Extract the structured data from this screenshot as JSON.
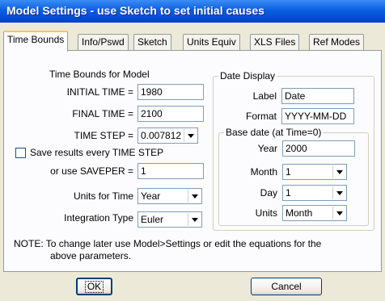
{
  "window": {
    "title": "Model Settings - use Sketch to set initial causes"
  },
  "tabs": [
    {
      "label": "Time Bounds",
      "active": true
    },
    {
      "label": "Info/Pswd",
      "active": false
    },
    {
      "label": "Sketch",
      "active": false
    },
    {
      "label": "Units Equiv",
      "active": false
    },
    {
      "label": "XLS Files",
      "active": false
    },
    {
      "label": "Ref Modes",
      "active": false
    }
  ],
  "time_bounds": {
    "heading": "Time Bounds for Model",
    "initial_time": {
      "label": "INITIAL TIME =",
      "value": "1980"
    },
    "final_time": {
      "label": "FINAL TIME =",
      "value": "2100"
    },
    "time_step": {
      "label": "TIME STEP =",
      "value": "0.007812"
    },
    "save_every": {
      "label": "Save results every TIME STEP",
      "checked": false
    },
    "saveper": {
      "label": "or use SAVEPER =",
      "value": "1"
    },
    "units": {
      "label": "Units for Time",
      "value": "Year"
    },
    "integration": {
      "label": "Integration Type",
      "value": "Euler"
    }
  },
  "date_display": {
    "legend": "Date Display",
    "label": {
      "label": "Label",
      "value": "Date"
    },
    "format": {
      "label": "Format",
      "value": "YYYY-MM-DD"
    },
    "base_date": {
      "legend": "Base date (at Time=0)",
      "year": {
        "label": "Year",
        "value": "2000"
      },
      "month": {
        "label": "Month",
        "value": "1"
      },
      "day": {
        "label": "Day",
        "value": "1"
      },
      "units": {
        "label": "Units",
        "value": "Month"
      }
    }
  },
  "note": {
    "line1": "NOTE:  To change later use Model>Settings or edit the equations for the",
    "line2": "above parameters."
  },
  "buttons": {
    "ok": "OK",
    "cancel": "Cancel"
  }
}
